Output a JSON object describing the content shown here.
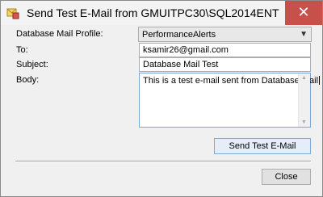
{
  "window": {
    "title": "Send Test E-Mail from GMUITPC30\\SQL2014ENT",
    "close_glyph": "✕"
  },
  "form": {
    "profile_label": "Database Mail Profile:",
    "profile_value": "PerformanceAlerts",
    "to_label": "To:",
    "to_value": "ksamir26@gmail.com",
    "subject_label": "Subject:",
    "subject_value": "Database Mail Test",
    "body_label": "Body:",
    "body_value": "This is a test e-mail sent from Database Mail"
  },
  "buttons": {
    "send_label": "Send Test E-Mail",
    "close_label": "Close"
  },
  "icons": {
    "app": "sql-server-mail-icon",
    "dropdown": "chevron-down-icon",
    "scroll_up": "scroll-up-arrow-icon",
    "scroll_down": "scroll-down-arrow-icon"
  },
  "colors": {
    "close_button": "#c7504b",
    "focus_border": "#7aa7d8"
  }
}
